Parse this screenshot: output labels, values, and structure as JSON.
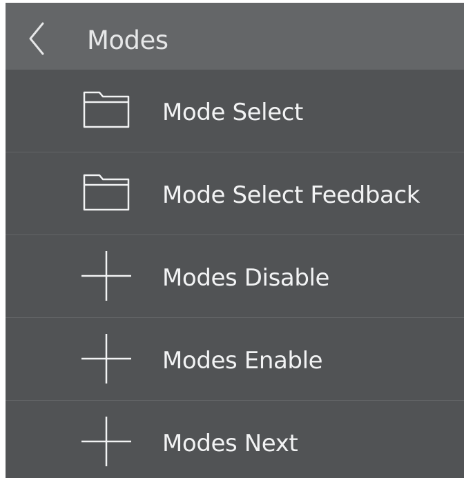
{
  "header": {
    "back_icon": "chevron-left-icon",
    "title": "Modes"
  },
  "items": [
    {
      "label": "Mode Select",
      "icon": "folder-icon"
    },
    {
      "label": "Mode Select Feedback",
      "icon": "folder-icon"
    },
    {
      "label": "Modes Disable",
      "icon": "plus-icon"
    },
    {
      "label": "Modes Enable",
      "icon": "plus-icon"
    },
    {
      "label": "Modes Next",
      "icon": "plus-icon"
    }
  ],
  "colors": {
    "header_background": "#646668",
    "list_background": "#515355",
    "text": "#f2f3f4",
    "divider": "#636567"
  }
}
